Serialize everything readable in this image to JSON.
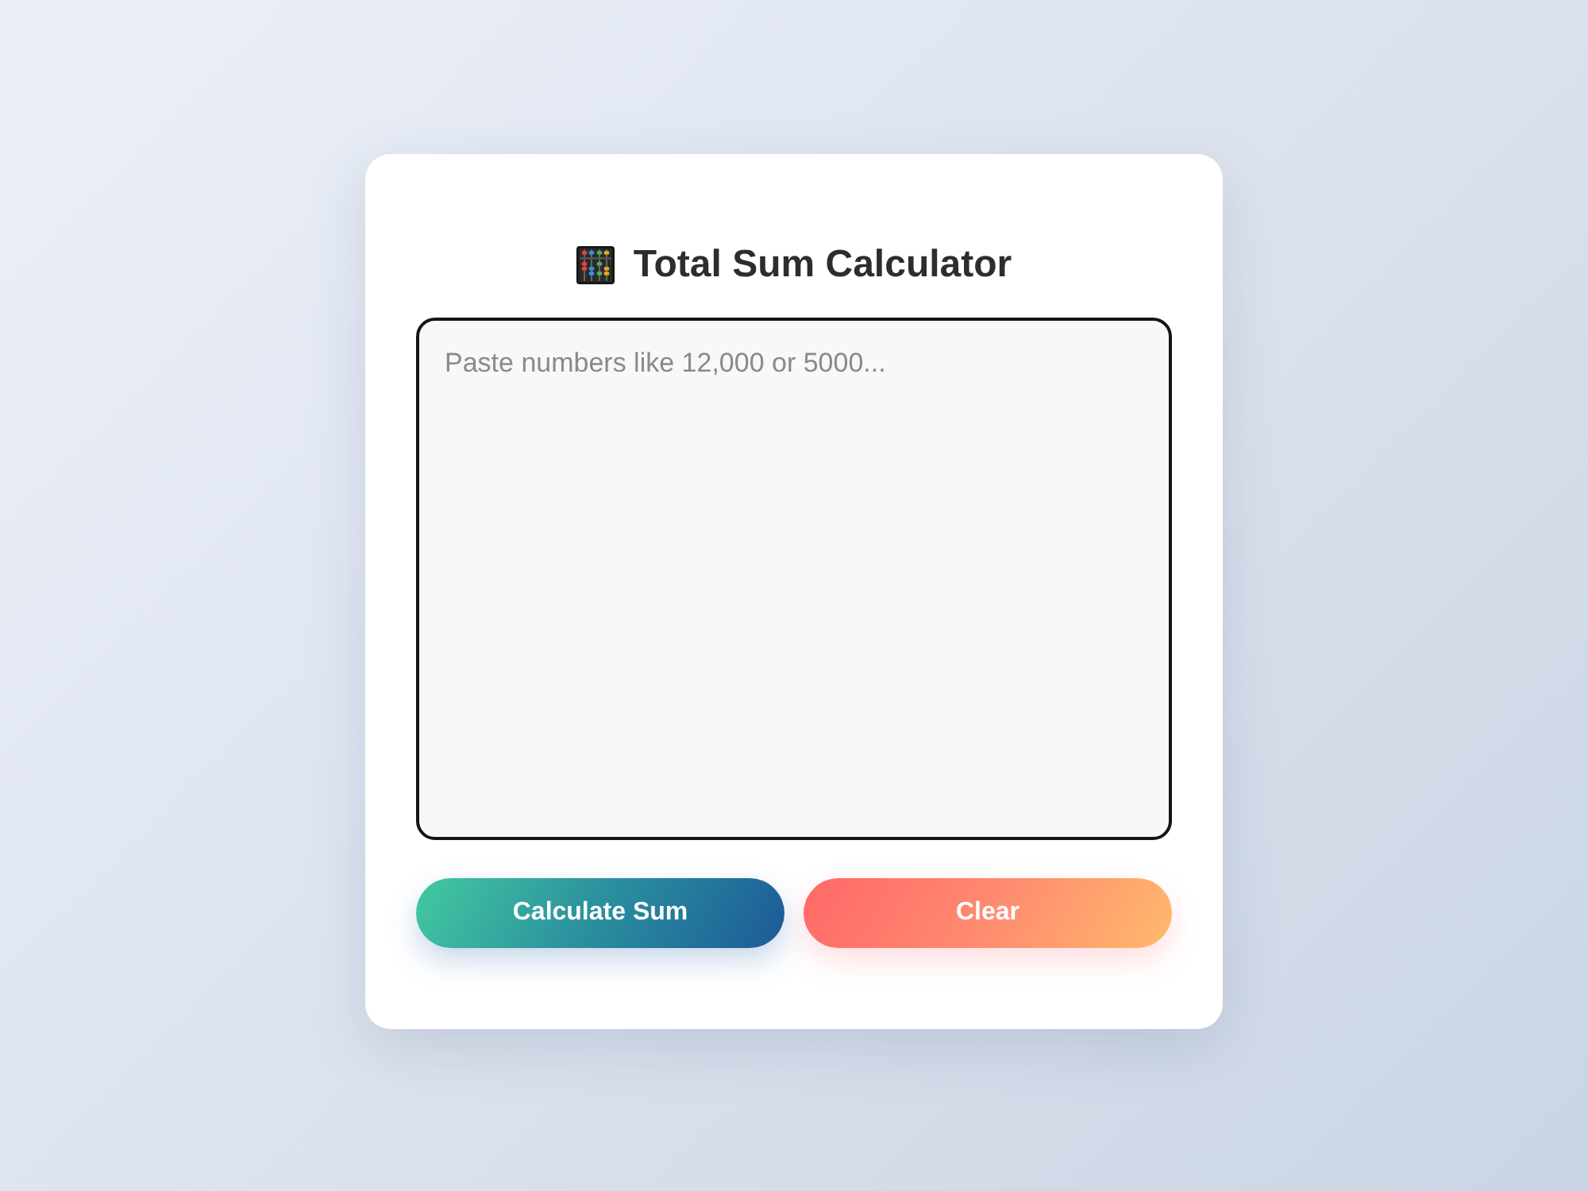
{
  "title": {
    "text": "Total Sum Calculator"
  },
  "input": {
    "placeholder": "Paste numbers like 12,000 or 5000..."
  },
  "buttons": [
    {
      "label": "Calculate Sum",
      "kind": "primary"
    },
    {
      "label": "Clear",
      "kind": "secondary"
    }
  ]
}
